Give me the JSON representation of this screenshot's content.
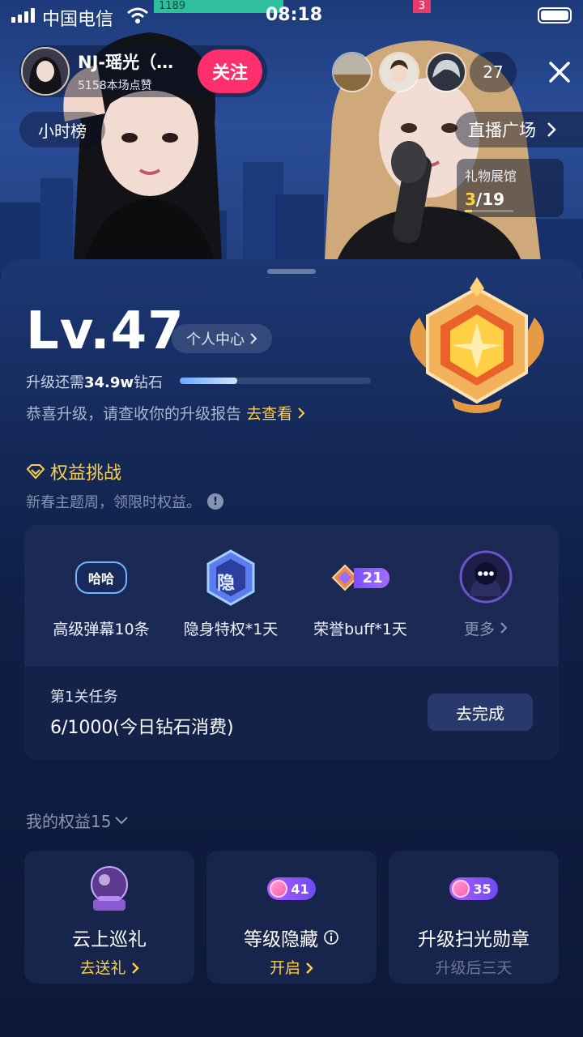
{
  "status_bar": {
    "carrier": "中国电信",
    "time": "08:18"
  },
  "pk_bar": {
    "left_score": "1189",
    "right_score": "3"
  },
  "host": {
    "name": "NJ-瑶光（…",
    "likes": "5158本场点赞",
    "follow_label": "关注"
  },
  "viewers": {
    "count": "27"
  },
  "hour_rank": "小时榜",
  "plaza": {
    "label": "直播广场"
  },
  "gift_hall": {
    "title": "礼物展馆",
    "current": "3",
    "total": "/19",
    "progress": 0.158
  },
  "level": {
    "label": "Lv.47",
    "personal_center": "个人中心",
    "upgrade_prefix": "升级还需",
    "upgrade_amount": "34.9w",
    "upgrade_suffix": "钻石",
    "progress": 0.3,
    "congrats_text": "恭喜升级，请查收你的升级报告",
    "congrats_link": "去查看"
  },
  "challenge": {
    "title": "权益挑战",
    "subtitle": "新春主题周，领限时权益。",
    "perks": [
      {
        "label": "高级弹幕10条",
        "badge": "哈哈"
      },
      {
        "label": "隐身特权*1天",
        "badge": "隐"
      },
      {
        "label": "荣誉buff*1天",
        "badge": "21"
      },
      {
        "label": "更多"
      }
    ],
    "task_title": "第1关任务",
    "task_progress": "6/1000(今日钻石消费)",
    "task_button": "去完成"
  },
  "my_rights": {
    "title": "我的权益15",
    "items": [
      {
        "title": "云上巡礼",
        "action": "去送礼"
      },
      {
        "title": "等级隐藏",
        "action": "开启",
        "badge": "41"
      },
      {
        "title": "升级扫光勋章",
        "action": "升级后三天",
        "badge": "35"
      }
    ]
  },
  "colors": {
    "accent_gold": "#ffcf45",
    "follow_pink": "#ff2f6e",
    "sheet_bg": "#0f1f45"
  },
  "icons": [
    "signal-icon",
    "wifi-icon",
    "battery-icon",
    "close-icon",
    "chevron-right-icon",
    "diamond-icon",
    "info-icon",
    "chevron-down-icon"
  ]
}
